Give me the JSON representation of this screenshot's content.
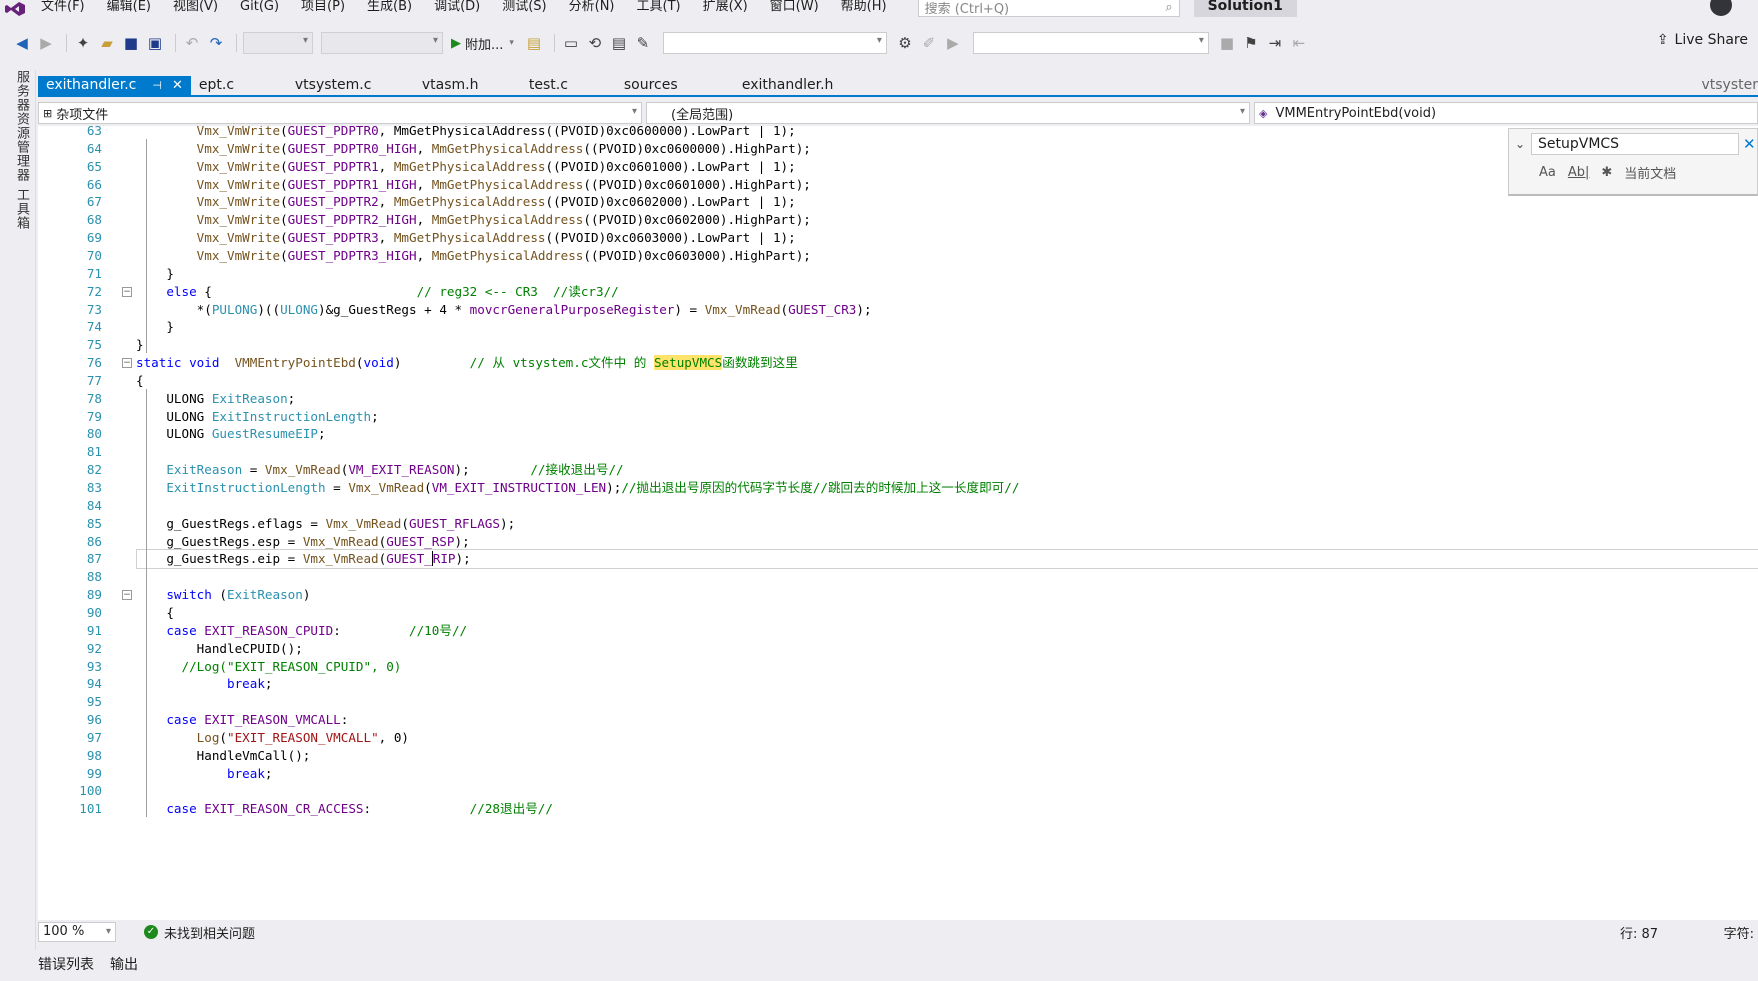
{
  "menu": [
    "文件(F)",
    "编辑(E)",
    "视图(V)",
    "Git(G)",
    "项目(P)",
    "生成(B)",
    "调试(D)",
    "测试(S)",
    "分析(N)",
    "工具(T)",
    "扩展(X)",
    "窗口(W)",
    "帮助(H)"
  ],
  "search_placeholder": "搜索 (Ctrl+Q)",
  "solution_name": "Solution1",
  "toolbar": {
    "attach_label": "附加...",
    "live_share": "Live Share"
  },
  "left_rail": [
    "服务器资源管理器",
    "工具箱"
  ],
  "doc_tabs": [
    "exithandler.c",
    "ept.c",
    "vtsystem.c",
    "vtasm.h",
    "test.c",
    "sources",
    "exithandler.h"
  ],
  "doc_tab_overflow": "vtsyster",
  "nav": {
    "project": "杂项文件",
    "scope": "(全局范围)",
    "member": "VMMEntryPointEbd(void)"
  },
  "find": {
    "query": "SetupVMCS",
    "scope_label": "当前文档",
    "opt_case": "Aa",
    "opt_word": "Ab|"
  },
  "status": {
    "zoom": "100 %",
    "issues": "未找到相关问题",
    "line": "行: 87",
    "char": "字符:"
  },
  "bottom_tabs": [
    "错误列表",
    "输出"
  ],
  "colors": {
    "accent": "#007acc",
    "keyword": "#0000ff",
    "comment": "#008000",
    "macro": "#6f008a",
    "type": "#2b91af",
    "function": "#74531f",
    "string": "#a31515",
    "highlight": "#ffe36b"
  },
  "editor": {
    "line_numbers": [
      "63",
      "64",
      "65",
      "66",
      "67",
      "68",
      "69",
      "70",
      "71",
      "72",
      "73",
      "74",
      "75",
      "76",
      "77",
      "78",
      "79",
      "80",
      "81",
      "82",
      "83",
      "84",
      "85",
      "86",
      "87",
      "88",
      "89",
      "90",
      "91",
      "92",
      "93",
      "94",
      "95",
      "96",
      "97",
      "98",
      "99",
      "100",
      "101"
    ],
    "lines": [
      [
        [
          "        ",
          ""
        ],
        [
          "Vmx_VmWrite",
          "fn"
        ],
        [
          "(",
          ""
        ],
        [
          "GUEST_PDPTR0",
          "mac"
        ],
        [
          ", ",
          ""
        ],
        [
          "MmGetPhysicalAddress",
          ""
        ],
        [
          "((PVOID)0xc0600000).LowPart | 1);",
          ""
        ]
      ],
      [
        [
          "        ",
          ""
        ],
        [
          "Vmx_VmWrite",
          "fn"
        ],
        [
          "(",
          ""
        ],
        [
          "GUEST_PDPTR0_HIGH",
          "mac"
        ],
        [
          ", ",
          ""
        ],
        [
          "MmGetPhysicalAddress",
          "fn"
        ],
        [
          "((PVOID)0xc0600000).HighPart);",
          ""
        ]
      ],
      [
        [
          "        ",
          ""
        ],
        [
          "Vmx_VmWrite",
          "fn"
        ],
        [
          "(",
          ""
        ],
        [
          "GUEST_PDPTR1",
          "mac"
        ],
        [
          ", ",
          ""
        ],
        [
          "MmGetPhysicalAddress",
          "fn"
        ],
        [
          "((PVOID)0xc0601000).LowPart | 1);",
          ""
        ]
      ],
      [
        [
          "        ",
          ""
        ],
        [
          "Vmx_VmWrite",
          "fn"
        ],
        [
          "(",
          ""
        ],
        [
          "GUEST_PDPTR1_HIGH",
          "mac"
        ],
        [
          ", ",
          ""
        ],
        [
          "MmGetPhysicalAddress",
          "fn"
        ],
        [
          "((PVOID)0xc0601000).HighPart);",
          ""
        ]
      ],
      [
        [
          "        ",
          ""
        ],
        [
          "Vmx_VmWrite",
          "fn"
        ],
        [
          "(",
          ""
        ],
        [
          "GUEST_PDPTR2",
          "mac"
        ],
        [
          ", ",
          ""
        ],
        [
          "MmGetPhysicalAddress",
          "fn"
        ],
        [
          "((PVOID)0xc0602000).LowPart | 1);",
          ""
        ]
      ],
      [
        [
          "        ",
          ""
        ],
        [
          "Vmx_VmWrite",
          "fn"
        ],
        [
          "(",
          ""
        ],
        [
          "GUEST_PDPTR2_HIGH",
          "mac"
        ],
        [
          ", ",
          ""
        ],
        [
          "MmGetPhysicalAddress",
          "fn"
        ],
        [
          "((PVOID)0xc0602000).HighPart);",
          ""
        ]
      ],
      [
        [
          "        ",
          ""
        ],
        [
          "Vmx_VmWrite",
          "fn"
        ],
        [
          "(",
          ""
        ],
        [
          "GUEST_PDPTR3",
          "mac"
        ],
        [
          ", ",
          ""
        ],
        [
          "MmGetPhysicalAddress",
          "fn"
        ],
        [
          "((PVOID)0xc0603000).LowPart | 1);",
          ""
        ]
      ],
      [
        [
          "        ",
          ""
        ],
        [
          "Vmx_VmWrite",
          "fn"
        ],
        [
          "(",
          ""
        ],
        [
          "GUEST_PDPTR3_HIGH",
          "mac"
        ],
        [
          ", ",
          ""
        ],
        [
          "MmGetPhysicalAddress",
          "fn"
        ],
        [
          "((PVOID)0xc0603000).HighPart);",
          ""
        ]
      ],
      [
        [
          "    }",
          ""
        ]
      ],
      [
        [
          "    ",
          ""
        ],
        [
          "else",
          "kw"
        ],
        [
          " {                           ",
          ""
        ],
        [
          "// reg32 <-- CR3  //读cr3//",
          "cm"
        ]
      ],
      [
        [
          "        *(",
          ""
        ],
        [
          "PULONG",
          "ty"
        ],
        [
          ")((",
          ""
        ],
        [
          "ULONG",
          "ty"
        ],
        [
          ")&g_GuestRegs + 4 * ",
          ""
        ],
        [
          "movcrGeneralPurposeRegister",
          "mac"
        ],
        [
          ") = ",
          ""
        ],
        [
          "Vmx_VmRead",
          "fn"
        ],
        [
          "(",
          ""
        ],
        [
          "GUEST_CR3",
          "mac"
        ],
        [
          ");",
          ""
        ]
      ],
      [
        [
          "    }",
          ""
        ]
      ],
      [
        [
          "}",
          ""
        ]
      ],
      [
        [
          "static void",
          "kw"
        ],
        [
          "  ",
          ""
        ],
        [
          "VMMEntryPointEbd",
          "fn"
        ],
        [
          "(",
          ""
        ],
        [
          "void",
          "kw"
        ],
        [
          ")         ",
          ""
        ],
        [
          "// 从 vtsystem.c文件中 的 ",
          "cm"
        ],
        [
          "SetupVMCS",
          "cm hl"
        ],
        [
          "函数跳到这里",
          "cm"
        ]
      ],
      [
        [
          "{",
          ""
        ]
      ],
      [
        [
          "    ULONG ",
          ""
        ],
        [
          "ExitReason",
          "ty"
        ],
        [
          ";",
          ""
        ]
      ],
      [
        [
          "    ULONG ",
          ""
        ],
        [
          "ExitInstructionLength",
          "ty"
        ],
        [
          ";",
          ""
        ]
      ],
      [
        [
          "    ULONG ",
          ""
        ],
        [
          "GuestResumeEIP",
          "ty"
        ],
        [
          ";",
          ""
        ]
      ],
      [
        [
          "",
          ""
        ]
      ],
      [
        [
          "    ",
          ""
        ],
        [
          "ExitReason",
          "ty"
        ],
        [
          " = ",
          ""
        ],
        [
          "Vmx_VmRead",
          "fn"
        ],
        [
          "(",
          ""
        ],
        [
          "VM_EXIT_REASON",
          "mac"
        ],
        [
          ");        ",
          ""
        ],
        [
          "//接收退出号//",
          "cm"
        ]
      ],
      [
        [
          "    ",
          ""
        ],
        [
          "ExitInstructionLength",
          "ty"
        ],
        [
          " = ",
          ""
        ],
        [
          "Vmx_VmRead",
          "fn"
        ],
        [
          "(",
          ""
        ],
        [
          "VM_EXIT_INSTRUCTION_LEN",
          "mac"
        ],
        [
          ");",
          ""
        ],
        [
          "//抛出退出号原因的代码字节长度//跳回去的时候加上这一长度即可//",
          "cm"
        ]
      ],
      [
        [
          "",
          ""
        ]
      ],
      [
        [
          "    g_GuestRegs.eflags = ",
          ""
        ],
        [
          "Vmx_VmRead",
          "fn"
        ],
        [
          "(",
          ""
        ],
        [
          "GUEST_RFLAGS",
          "mac"
        ],
        [
          ");",
          ""
        ]
      ],
      [
        [
          "    g_GuestRegs.esp = ",
          ""
        ],
        [
          "Vmx_VmRead",
          "fn"
        ],
        [
          "(",
          ""
        ],
        [
          "GUEST_RSP",
          "mac"
        ],
        [
          ");",
          ""
        ]
      ],
      [
        [
          "    g_GuestRegs.eip = ",
          ""
        ],
        [
          "Vmx_VmRead",
          "fn"
        ],
        [
          "(",
          ""
        ],
        [
          "GUEST_",
          "mac"
        ],
        [
          "RIP",
          "mac cur"
        ],
        [
          ");",
          ""
        ]
      ],
      [
        [
          "",
          ""
        ]
      ],
      [
        [
          "    ",
          ""
        ],
        [
          "switch",
          "kw"
        ],
        [
          " (",
          ""
        ],
        [
          "ExitReason",
          "ty"
        ],
        [
          ")",
          ""
        ]
      ],
      [
        [
          "    {",
          ""
        ]
      ],
      [
        [
          "    ",
          ""
        ],
        [
          "case",
          "kw"
        ],
        [
          " ",
          ""
        ],
        [
          "EXIT_REASON_CPUID",
          "mac"
        ],
        [
          ":         ",
          ""
        ],
        [
          "//10号//",
          "cm"
        ]
      ],
      [
        [
          "        HandleCPUID();",
          ""
        ]
      ],
      [
        [
          "      ",
          ""
        ],
        [
          "//Log(\"EXIT_REASON_CPUID\", 0)",
          "cm"
        ]
      ],
      [
        [
          "            ",
          ""
        ],
        [
          "break",
          "kw"
        ],
        [
          ";",
          ""
        ]
      ],
      [
        [
          "",
          ""
        ]
      ],
      [
        [
          "    ",
          ""
        ],
        [
          "case",
          "kw"
        ],
        [
          " ",
          ""
        ],
        [
          "EXIT_REASON_VMCALL",
          "mac"
        ],
        [
          ":",
          ""
        ]
      ],
      [
        [
          "        ",
          ""
        ],
        [
          "Log",
          "fn"
        ],
        [
          "(",
          ""
        ],
        [
          "\"EXIT_REASON_VMCALL\"",
          "str"
        ],
        [
          ", 0)",
          ""
        ]
      ],
      [
        [
          "        HandleVmCall();",
          ""
        ]
      ],
      [
        [
          "            ",
          ""
        ],
        [
          "break",
          "kw"
        ],
        [
          ";",
          ""
        ]
      ],
      [
        [
          "",
          ""
        ]
      ],
      [
        [
          "    ",
          ""
        ],
        [
          "case",
          "kw"
        ],
        [
          " ",
          ""
        ],
        [
          "EXIT_REASON_CR_ACCESS",
          "mac"
        ],
        [
          ":             ",
          ""
        ],
        [
          "//28退出号//",
          "cm"
        ]
      ]
    ]
  }
}
